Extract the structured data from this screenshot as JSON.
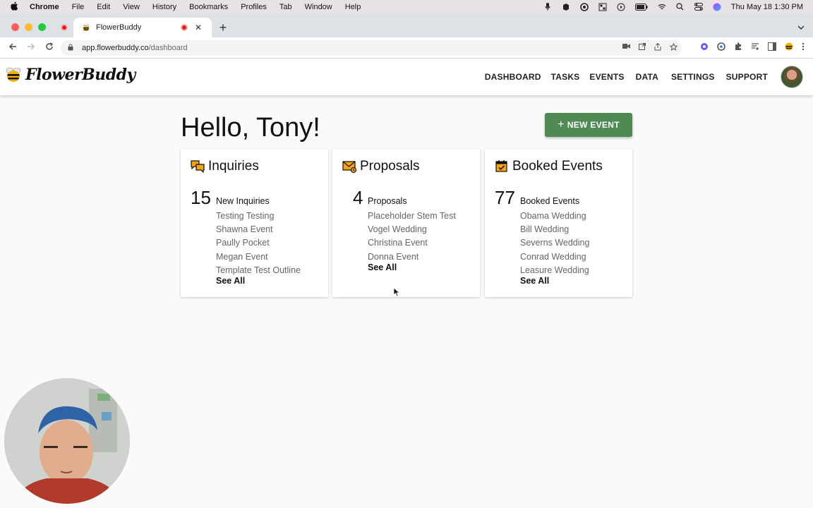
{
  "menubar": {
    "app": "Chrome",
    "items": [
      "File",
      "Edit",
      "View",
      "History",
      "Bookmarks",
      "Profiles",
      "Tab",
      "Window",
      "Help"
    ],
    "datetime": "Thu May 18  1:30 PM"
  },
  "browser": {
    "tab_title": "FlowerBuddy",
    "url_host": "app.flowerbuddy.co",
    "url_path": "/dashboard"
  },
  "header": {
    "logo_text": "FlowerBuddy",
    "nav": [
      "DASHBOARD",
      "TASKS",
      "EVENTS",
      "DATA",
      "SETTINGS",
      "SUPPORT"
    ]
  },
  "main": {
    "greeting": "Hello, Tony!",
    "new_event_label": "NEW EVENT"
  },
  "cards": {
    "inquiries": {
      "title": "Inquiries",
      "count": "15",
      "label": "New Inquiries",
      "items": [
        "Testing Testing",
        "Shawna Event",
        "Paully Pocket",
        "Megan Event",
        "Template Test Outline"
      ],
      "see_all": "See All"
    },
    "proposals": {
      "title": "Proposals",
      "count": "4",
      "label": "Proposals",
      "items": [
        "Placeholder Stem Test",
        "Vogel Wedding",
        "Christina Event",
        "Donna Event"
      ],
      "see_all": "See All"
    },
    "booked": {
      "title": "Booked Events",
      "count": "77",
      "label": "Booked Events",
      "items": [
        "Obama Wedding",
        "Bill Wedding",
        "Severns Wedding",
        "Conrad Wedding",
        "Leasure Wedding"
      ],
      "see_all": "See All"
    }
  },
  "colors": {
    "accent_green": "#4f8a55",
    "icon_orange": "#f2a417"
  }
}
